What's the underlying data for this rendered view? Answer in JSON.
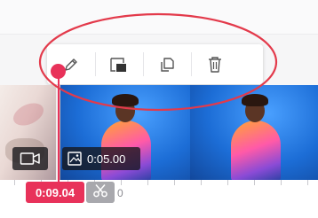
{
  "toolbar": {
    "buttons": [
      {
        "name": "edit",
        "icon": "pencil-icon"
      },
      {
        "name": "replace",
        "icon": "replace-media-icon"
      },
      {
        "name": "duplicate",
        "icon": "duplicate-icon"
      },
      {
        "name": "delete",
        "icon": "trash-icon"
      }
    ]
  },
  "timeline": {
    "clips": [
      {
        "type": "video",
        "icon": "video-camera-icon"
      },
      {
        "type": "image",
        "icon": "image-icon",
        "duration": "0:05.00"
      }
    ],
    "playhead_time": "0:09.04",
    "ruler_label": "0"
  },
  "colors": {
    "accent": "#e8325a",
    "track": "#2c7fd8",
    "annotation": "#e33a4b"
  }
}
